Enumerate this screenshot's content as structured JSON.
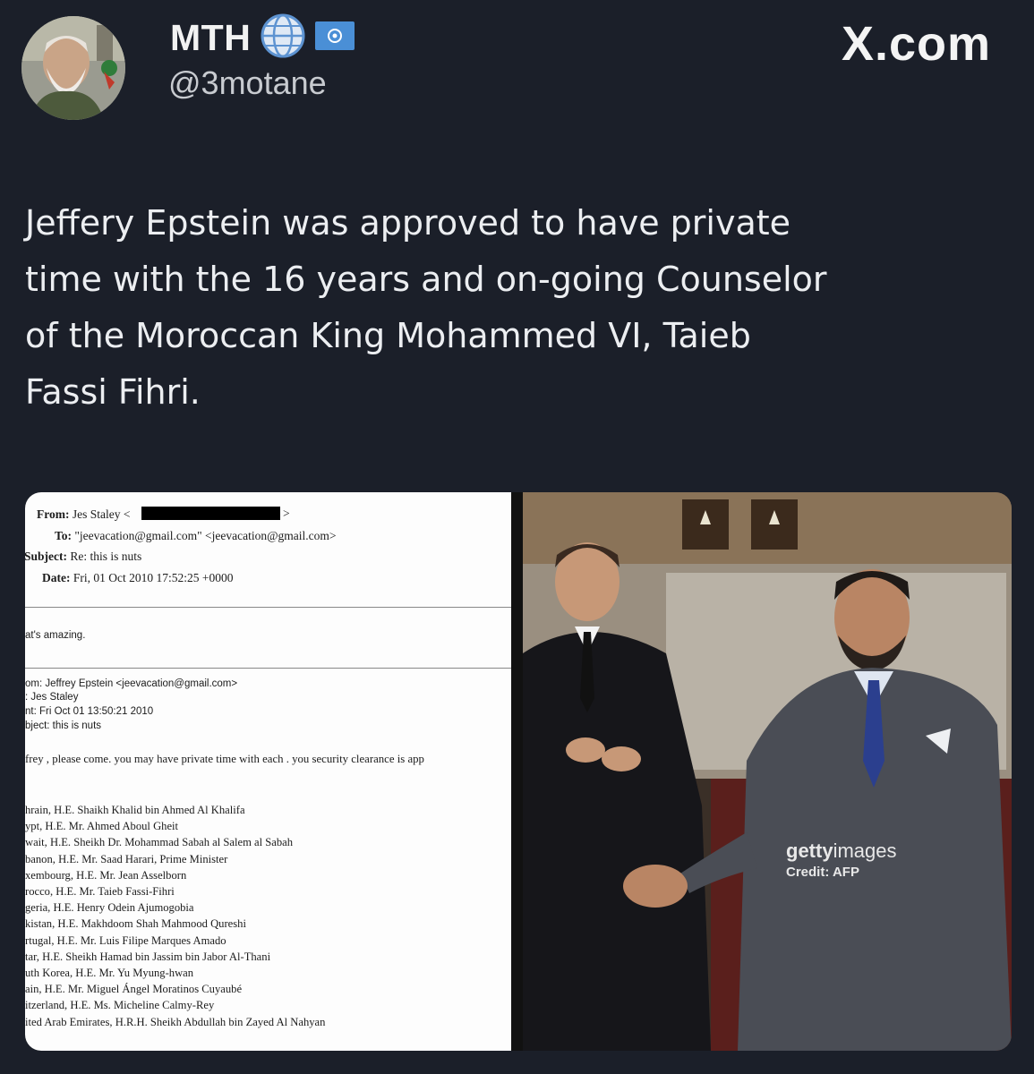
{
  "profile": {
    "display_name": "MTH",
    "handle": "@3motane",
    "avatar_icon": "profile-avatar",
    "badge_icons": [
      "globe-verified-icon",
      "un-flag-icon"
    ]
  },
  "brand": {
    "label": "X.com"
  },
  "post": {
    "text_lines": [
      "Jeffery Epstein was approved to have private",
      "time with the 16 years and on-going Counselor",
      "of the Moroccan King Mohammed VI, Taieb",
      "Fassi Fihri."
    ]
  },
  "email": {
    "from_label": "From:",
    "from_value": "Jes Staley <",
    "to_label": "To:",
    "to_value": "\"jeevacation@gmail.com\" <jeevacation@gmail.com>",
    "subject_label": "Subject:",
    "subject_value": "Re: this is nuts",
    "date_label": "Date:",
    "date_value": "Fri, 01 Oct 2010 17:52:25 +0000",
    "reply": "at's amazing.",
    "orig_from": "om: Jeffrey Epstein <jeevacation@gmail.com>",
    "orig_to": ": Jes Staley",
    "orig_sent": "nt: Fri Oct 01 13:50:21 2010",
    "orig_subject": "bject: this is nuts",
    "body": "frey , please come.   you may have private time with each .  you security clearance is app",
    "list": [
      "hrain, H.E. Shaikh Khalid bin Ahmed Al Khalifa",
      "ypt, H.E. Mr. Ahmed Aboul Gheit",
      "wait, H.E. Sheikh Dr. Mohammad Sabah al Salem al Sabah",
      "banon, H.E. Mr. Saad Harari, Prime Minister",
      "xembourg, H.E. Mr. Jean Asselborn",
      "rocco, H.E. Mr. Taieb Fassi-Fihri",
      "geria, H.E. Henry Odein Ajumogobia",
      "kistan, H.E. Makhdoom Shah Mahmood Qureshi",
      "rtugal, H.E. Mr. Luis Filipe Marques Amado",
      "tar, H.E. Sheikh Hamad bin Jassim bin Jabor Al-Thani",
      "uth Korea, H.E. Mr. Yu Myung-hwan",
      "ain, H.E. Mr. Miguel Ángel Moratinos Cuyaubé",
      "itzerland, H.E. Ms. Micheline Calmy-Rey",
      "ited Arab Emirates, H.R.H. Sheikh Abdullah bin Zayed Al Nahyan"
    ]
  },
  "photo": {
    "watermark_bold": "getty",
    "watermark_rest": "images",
    "credit": "Credit: AFP"
  }
}
